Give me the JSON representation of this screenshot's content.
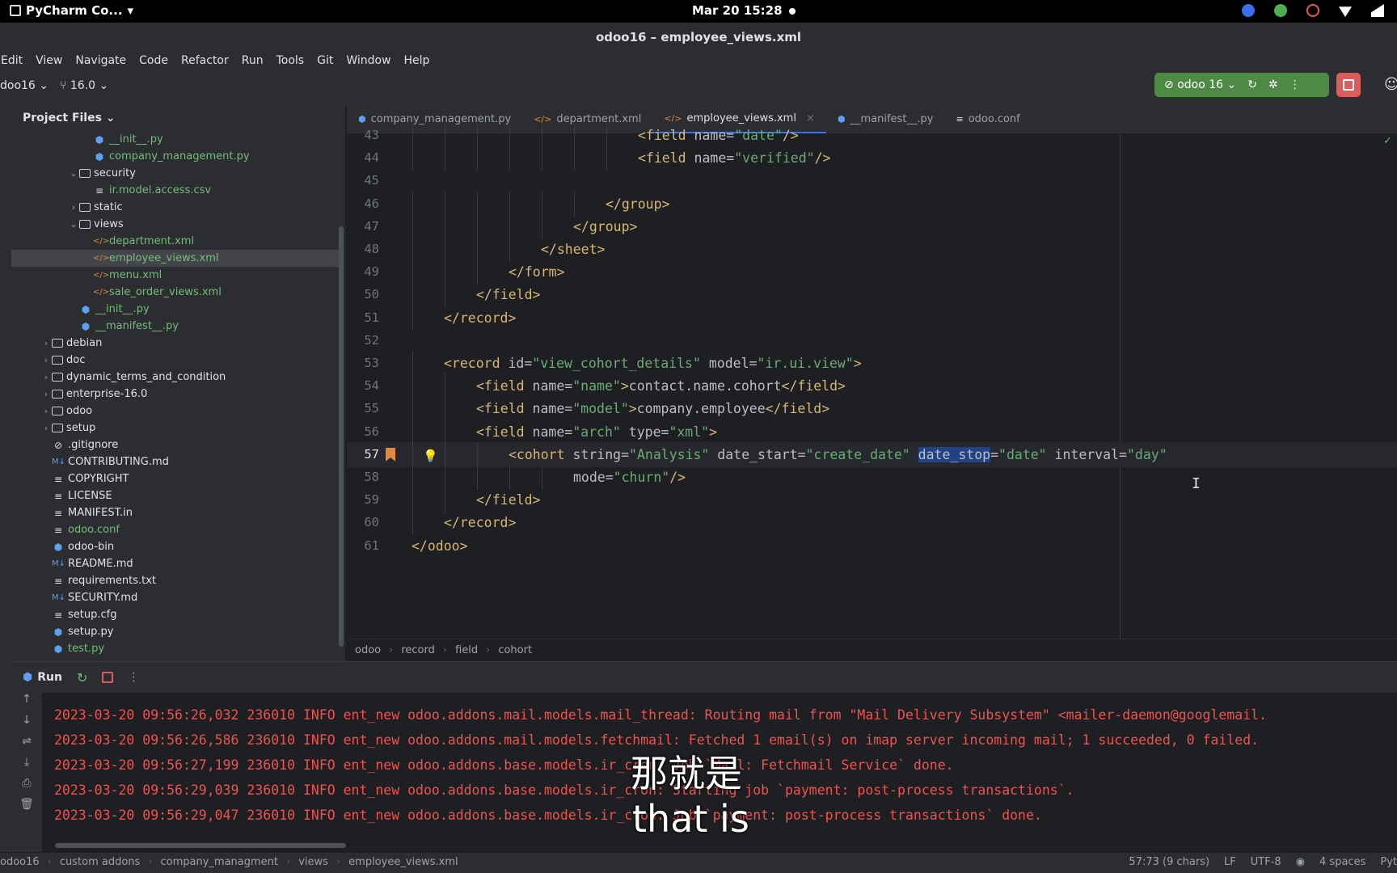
{
  "topbar": {
    "app_name": "PyCharm Co...",
    "clock": "Mar 20  15:28"
  },
  "window": {
    "title": "odoo16 – employee_views.xml"
  },
  "menu": [
    "Edit",
    "View",
    "Navigate",
    "Code",
    "Refactor",
    "Run",
    "Tools",
    "Git",
    "Window",
    "Help"
  ],
  "toolbar": {
    "project": "doo16 ⌄",
    "branch": "16.0 ⌄",
    "run_config": "odoo 16 ⌄"
  },
  "project_panel": {
    "title": "Project Files ⌄",
    "items": [
      {
        "label": "__init__.py",
        "indent": 5,
        "kind": "py",
        "color": "green"
      },
      {
        "label": "company_management.py",
        "indent": 5,
        "kind": "py",
        "color": "green"
      },
      {
        "label": "security",
        "indent": 4,
        "kind": "folder",
        "open": true,
        "color": "white"
      },
      {
        "label": "ir.model.access.csv",
        "indent": 5,
        "kind": "text",
        "color": "green"
      },
      {
        "label": "static",
        "indent": 4,
        "kind": "folder",
        "open": false,
        "color": "white"
      },
      {
        "label": "views",
        "indent": 4,
        "kind": "folder",
        "open": true,
        "color": "white"
      },
      {
        "label": "department.xml",
        "indent": 5,
        "kind": "xml",
        "color": "green"
      },
      {
        "label": "employee_views.xml",
        "indent": 5,
        "kind": "xml",
        "color": "green",
        "selected": true
      },
      {
        "label": "menu.xml",
        "indent": 5,
        "kind": "xml",
        "color": "green"
      },
      {
        "label": "sale_order_views.xml",
        "indent": 5,
        "kind": "xml",
        "color": "green"
      },
      {
        "label": "__init__.py",
        "indent": 4,
        "kind": "py",
        "color": "green"
      },
      {
        "label": "__manifest__.py",
        "indent": 4,
        "kind": "py",
        "color": "green"
      },
      {
        "label": "debian",
        "indent": 2,
        "kind": "folder",
        "open": false,
        "color": "white"
      },
      {
        "label": "doc",
        "indent": 2,
        "kind": "folder",
        "open": false,
        "color": "white"
      },
      {
        "label": "dynamic_terms_and_condition",
        "indent": 2,
        "kind": "folder",
        "open": false,
        "color": "white"
      },
      {
        "label": "enterprise-16.0",
        "indent": 2,
        "kind": "folder",
        "open": false,
        "color": "white"
      },
      {
        "label": "odoo",
        "indent": 2,
        "kind": "folder",
        "open": false,
        "color": "white"
      },
      {
        "label": "setup",
        "indent": 2,
        "kind": "folder",
        "open": false,
        "color": "white"
      },
      {
        "label": ".gitignore",
        "indent": 2,
        "kind": "ignore",
        "color": "white"
      },
      {
        "label": "CONTRIBUTING.md",
        "indent": 2,
        "kind": "md",
        "color": "white"
      },
      {
        "label": "COPYRIGHT",
        "indent": 2,
        "kind": "text",
        "color": "white"
      },
      {
        "label": "LICENSE",
        "indent": 2,
        "kind": "text",
        "color": "white"
      },
      {
        "label": "MANIFEST.in",
        "indent": 2,
        "kind": "text",
        "color": "white"
      },
      {
        "label": "odoo.conf",
        "indent": 2,
        "kind": "text",
        "color": "green"
      },
      {
        "label": "odoo-bin",
        "indent": 2,
        "kind": "py",
        "color": "white"
      },
      {
        "label": "README.md",
        "indent": 2,
        "kind": "md",
        "color": "white"
      },
      {
        "label": "requirements.txt",
        "indent": 2,
        "kind": "text",
        "color": "white"
      },
      {
        "label": "SECURITY.md",
        "indent": 2,
        "kind": "md",
        "color": "white"
      },
      {
        "label": "setup.cfg",
        "indent": 2,
        "kind": "text",
        "color": "white"
      },
      {
        "label": "setup.py",
        "indent": 2,
        "kind": "py",
        "color": "white"
      },
      {
        "label": "test.py",
        "indent": 2,
        "kind": "py",
        "color": "green"
      }
    ]
  },
  "tabs": [
    {
      "label": "company_management.py",
      "kind": "py"
    },
    {
      "label": "department.xml",
      "kind": "xml"
    },
    {
      "label": "employee_views.xml",
      "kind": "xml",
      "active": true
    },
    {
      "label": "__manifest__.py",
      "kind": "py"
    },
    {
      "label": "odoo.conf",
      "kind": "text"
    }
  ],
  "editor": {
    "current_line": 57,
    "lines": [
      {
        "no": "43",
        "indent": 7,
        "tokens": [
          [
            "tg",
            "<field "
          ],
          [
            "at",
            "name="
          ],
          [
            "vl",
            "\"date\""
          ],
          [
            "tg",
            "/>"
          ]
        ]
      },
      {
        "no": "44",
        "indent": 7,
        "tokens": [
          [
            "tg",
            "<field "
          ],
          [
            "at",
            "name="
          ],
          [
            "vl",
            "\"verified\""
          ],
          [
            "tg",
            "/>"
          ]
        ]
      },
      {
        "no": "45",
        "indent": 0,
        "tokens": []
      },
      {
        "no": "46",
        "indent": 6,
        "tokens": [
          [
            "tg",
            "</group>"
          ]
        ]
      },
      {
        "no": "47",
        "indent": 5,
        "tokens": [
          [
            "tg",
            "</group>"
          ]
        ]
      },
      {
        "no": "48",
        "indent": 4,
        "tokens": [
          [
            "tg",
            "</sheet>"
          ]
        ]
      },
      {
        "no": "49",
        "indent": 3,
        "tokens": [
          [
            "tg",
            "</form>"
          ]
        ]
      },
      {
        "no": "50",
        "indent": 2,
        "tokens": [
          [
            "tg",
            "</field>"
          ]
        ]
      },
      {
        "no": "51",
        "indent": 1,
        "tokens": [
          [
            "tg",
            "</record>"
          ]
        ]
      },
      {
        "no": "52",
        "indent": 0,
        "tokens": []
      },
      {
        "no": "53",
        "indent": 1,
        "tokens": [
          [
            "tg",
            "<record "
          ],
          [
            "at",
            "id="
          ],
          [
            "vl",
            "\"view_cohort_details\""
          ],
          [
            "at",
            " model="
          ],
          [
            "vl",
            "\"ir.ui.view\""
          ],
          [
            "tg",
            ">"
          ]
        ]
      },
      {
        "no": "54",
        "indent": 2,
        "tokens": [
          [
            "tg",
            "<field "
          ],
          [
            "at",
            "name="
          ],
          [
            "vl",
            "\"name\""
          ],
          [
            "tg",
            ">"
          ],
          [
            "tx",
            "contact.name.cohort"
          ],
          [
            "tg",
            "</field>"
          ]
        ]
      },
      {
        "no": "55",
        "indent": 2,
        "tokens": [
          [
            "tg",
            "<field "
          ],
          [
            "at",
            "name="
          ],
          [
            "vl",
            "\"model\""
          ],
          [
            "tg",
            ">"
          ],
          [
            "tx",
            "company.employee"
          ],
          [
            "tg",
            "</field>"
          ]
        ]
      },
      {
        "no": "56",
        "indent": 2,
        "tokens": [
          [
            "tg",
            "<field "
          ],
          [
            "at",
            "name="
          ],
          [
            "vl",
            "\"arch\""
          ],
          [
            "at",
            " type="
          ],
          [
            "vl",
            "\"xml\""
          ],
          [
            "tg",
            ">"
          ]
        ]
      },
      {
        "no": "57",
        "indent": 3,
        "tokens": [
          [
            "tg",
            "<cohort "
          ],
          [
            "at",
            "string="
          ],
          [
            "vl",
            "\"Analysis\""
          ],
          [
            "at",
            " date_start="
          ],
          [
            "vl",
            "\"create_date\""
          ],
          [
            "at",
            " "
          ],
          [
            "sel",
            "date_stop"
          ],
          [
            "at",
            "="
          ],
          [
            "vl",
            "\"date\""
          ],
          [
            "at",
            " interval="
          ],
          [
            "vl",
            "\"day\""
          ]
        ]
      },
      {
        "no": "58",
        "indent": 5,
        "tokens": [
          [
            "at",
            "mode="
          ],
          [
            "vl",
            "\"churn\""
          ],
          [
            "tg",
            "/>"
          ]
        ]
      },
      {
        "no": "59",
        "indent": 2,
        "tokens": [
          [
            "tg",
            "</field>"
          ]
        ]
      },
      {
        "no": "60",
        "indent": 1,
        "tokens": [
          [
            "tg",
            "</record>"
          ]
        ]
      },
      {
        "no": "61",
        "indent": 0,
        "tokens": [
          [
            "tg",
            "</odoo>"
          ]
        ]
      }
    ]
  },
  "breadcrumb": [
    "odoo",
    "record",
    "field",
    "cohort"
  ],
  "run_panel": {
    "title": "Run",
    "logs": [
      "2023-03-20 09:56:26,032 236010 INFO ent_new odoo.addons.mail.models.mail_thread: Routing mail from \"Mail Delivery Subsystem\" <mailer-daemon@googlemail.",
      "2023-03-20 09:56:26,586 236010 INFO ent_new odoo.addons.mail.models.fetchmail: Fetched 1 email(s) on imap server incoming mail; 1 succeeded, 0 failed.",
      "2023-03-20 09:56:27,199 236010 INFO ent_new odoo.addons.base.models.ir_cron: Job `Mail: Fetchmail Service` done.",
      "2023-03-20 09:56:29,039 236010 INFO ent_new odoo.addons.base.models.ir_cron: Starting job `payment: post-process transactions`.",
      "2023-03-20 09:56:29,047 236010 INFO ent_new odoo.addons.base.models.ir_cron: Job `payment: post-process transactions` done."
    ]
  },
  "subtitle": {
    "zh": "那就是",
    "en": "that is"
  },
  "statusbar": {
    "path": [
      "odoo16",
      "custom addons",
      "company_managment",
      "views",
      "employee_views.xml"
    ],
    "position": "57:73 (9 chars)",
    "line_sep": "LF",
    "encoding": "UTF-8",
    "indent": "4 spaces",
    "interpreter": "Pyt"
  }
}
